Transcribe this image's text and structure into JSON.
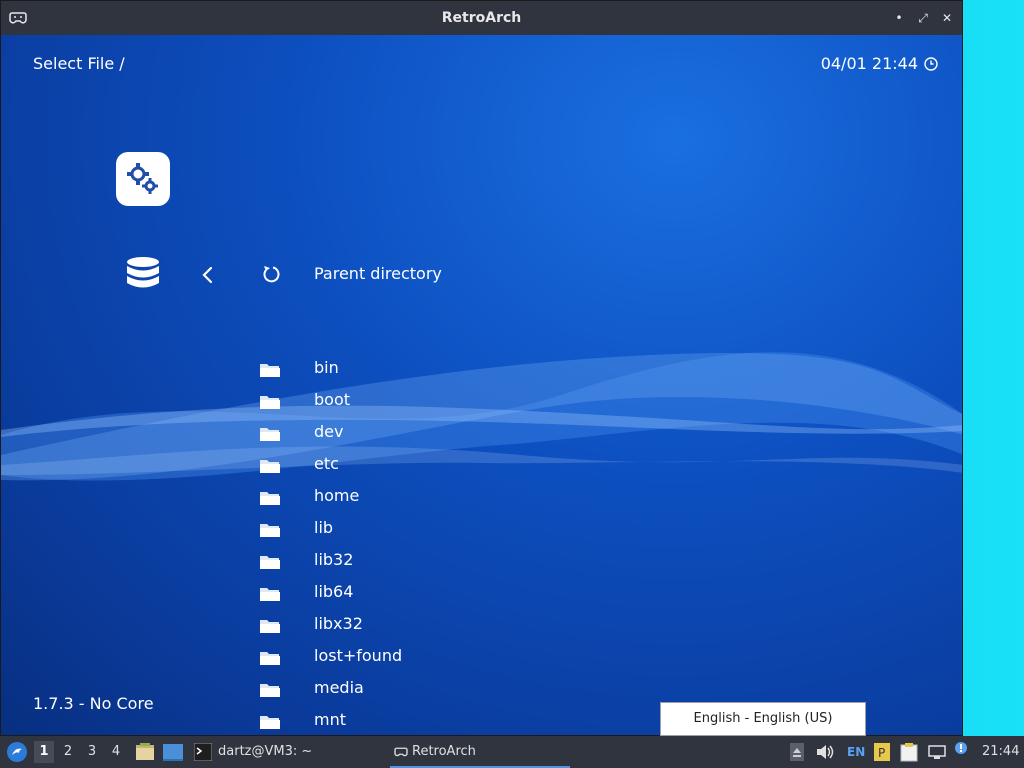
{
  "window": {
    "title": "RetroArch",
    "controls": {
      "minimize": "•",
      "maximize": "⤢",
      "close": "✕"
    }
  },
  "header": {
    "left": "Select File /",
    "right": "04/01 21:44"
  },
  "menu": {
    "parent_label": "Parent directory",
    "items": [
      "bin",
      "boot",
      "dev",
      "etc",
      "home",
      "lib",
      "lib32",
      "lib64",
      "libx32",
      "lost+found",
      "media",
      "mnt"
    ]
  },
  "footer": {
    "version": "1.7.3 - No Core"
  },
  "popup": {
    "language": "English - English (US)"
  },
  "taskbar": {
    "workspaces": [
      "1",
      "2",
      "3",
      "4"
    ],
    "active_workspace": "1",
    "terminal_task": "dartz@VM3: ~",
    "retro_task": "RetroArch",
    "keyboard_layout": "EN",
    "clock": "21:44"
  },
  "colors": {
    "titlebar": "#2f343f",
    "content_bg": "#0d4fc0",
    "accent": "#5294e2"
  }
}
